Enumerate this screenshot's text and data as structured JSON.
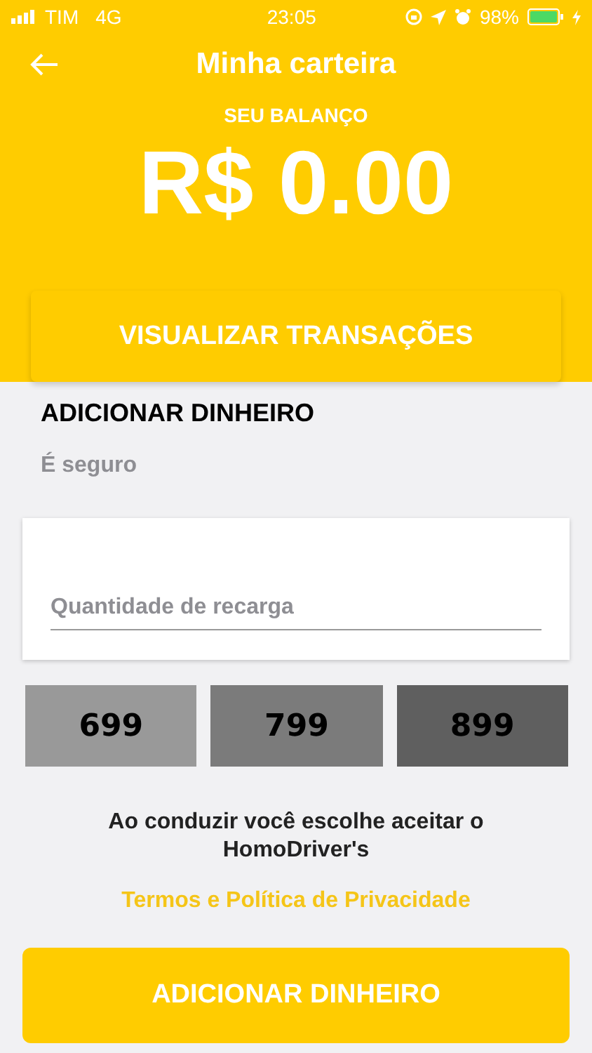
{
  "status_bar": {
    "carrier": "TIM",
    "network": "4G",
    "time": "23:05",
    "battery": "98%"
  },
  "header": {
    "title": "Minha carteira",
    "balance_label": "SEU BALANÇO",
    "balance": "R$ 0.00",
    "transactions_button": "VISUALIZAR TRANSAÇÕES"
  },
  "add_money": {
    "title": "ADICIONAR DINHEIRO",
    "subtitle": "É seguro",
    "amount_field": {
      "placeholder": "Quantidade de recarga"
    },
    "presets": [
      {
        "label": "699",
        "color": "#999999"
      },
      {
        "label": "799",
        "color": "#7b7b7b"
      },
      {
        "label": "899",
        "color": "#5f5f5f"
      }
    ],
    "notice": "Ao conduzir você escolhe aceitar o HomoDriver's",
    "terms_link": "Termos e Política de Privacidade",
    "submit_button": "ADICIONAR DINHEIRO"
  }
}
